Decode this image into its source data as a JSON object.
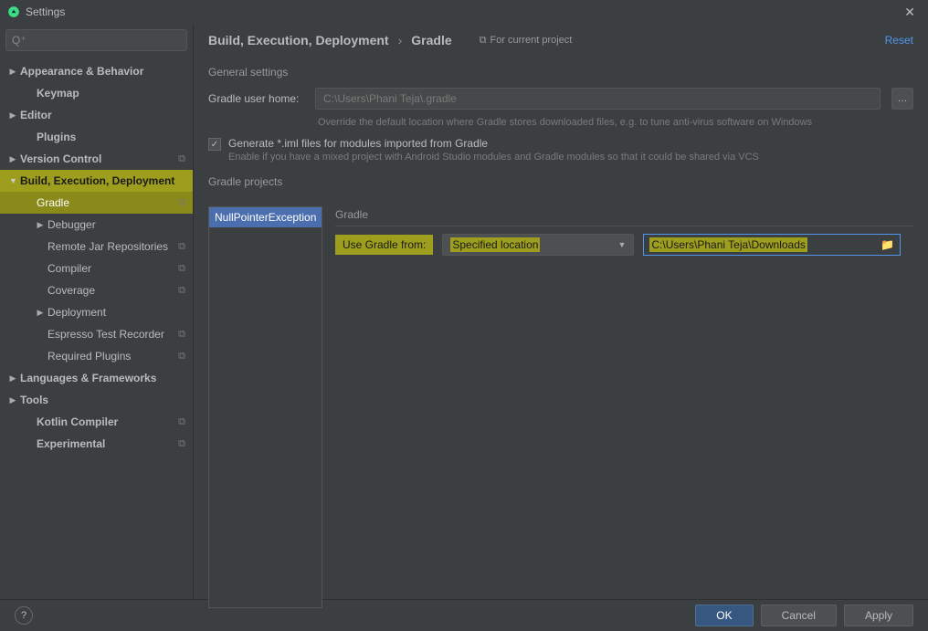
{
  "window": {
    "title": "Settings"
  },
  "search": {
    "placeholder": ""
  },
  "tree": {
    "appearance": "Appearance & Behavior",
    "keymap": "Keymap",
    "editor": "Editor",
    "plugins": "Plugins",
    "version_control": "Version Control",
    "build": "Build, Execution, Deployment",
    "build_children": {
      "gradle": "Gradle",
      "debugger": "Debugger",
      "remote_jar": "Remote Jar Repositories",
      "compiler": "Compiler",
      "coverage": "Coverage",
      "deployment": "Deployment",
      "espresso": "Espresso Test Recorder",
      "required_plugins": "Required Plugins"
    },
    "languages": "Languages & Frameworks",
    "tools": "Tools",
    "kotlin_compiler": "Kotlin Compiler",
    "experimental": "Experimental"
  },
  "breadcrumb": {
    "a": "Build, Execution, Deployment",
    "b": "Gradle"
  },
  "context": "For current project",
  "reset": "Reset",
  "general": {
    "header": "General settings",
    "home_label": "Gradle user home:",
    "home_placeholder": "C:\\Users\\Phani Teja\\.gradle",
    "home_desc": "Override the default location where Gradle stores downloaded files, e.g. to tune anti-virus software on Windows",
    "gen_iml_label": "Generate *.iml files for modules imported from Gradle",
    "gen_iml_desc": "Enable if you have a mixed project with Android Studio modules and Gradle modules so that it could be shared via VCS"
  },
  "projects": {
    "header": "Gradle projects",
    "item": "NullPointerException",
    "fieldset": "Gradle",
    "use_from_label": "Use Gradle from:",
    "use_from_value": "Specified location",
    "path_value": "C:\\Users\\Phani Teja\\Downloads"
  },
  "footer": {
    "ok": "OK",
    "cancel": "Cancel",
    "apply": "Apply"
  }
}
